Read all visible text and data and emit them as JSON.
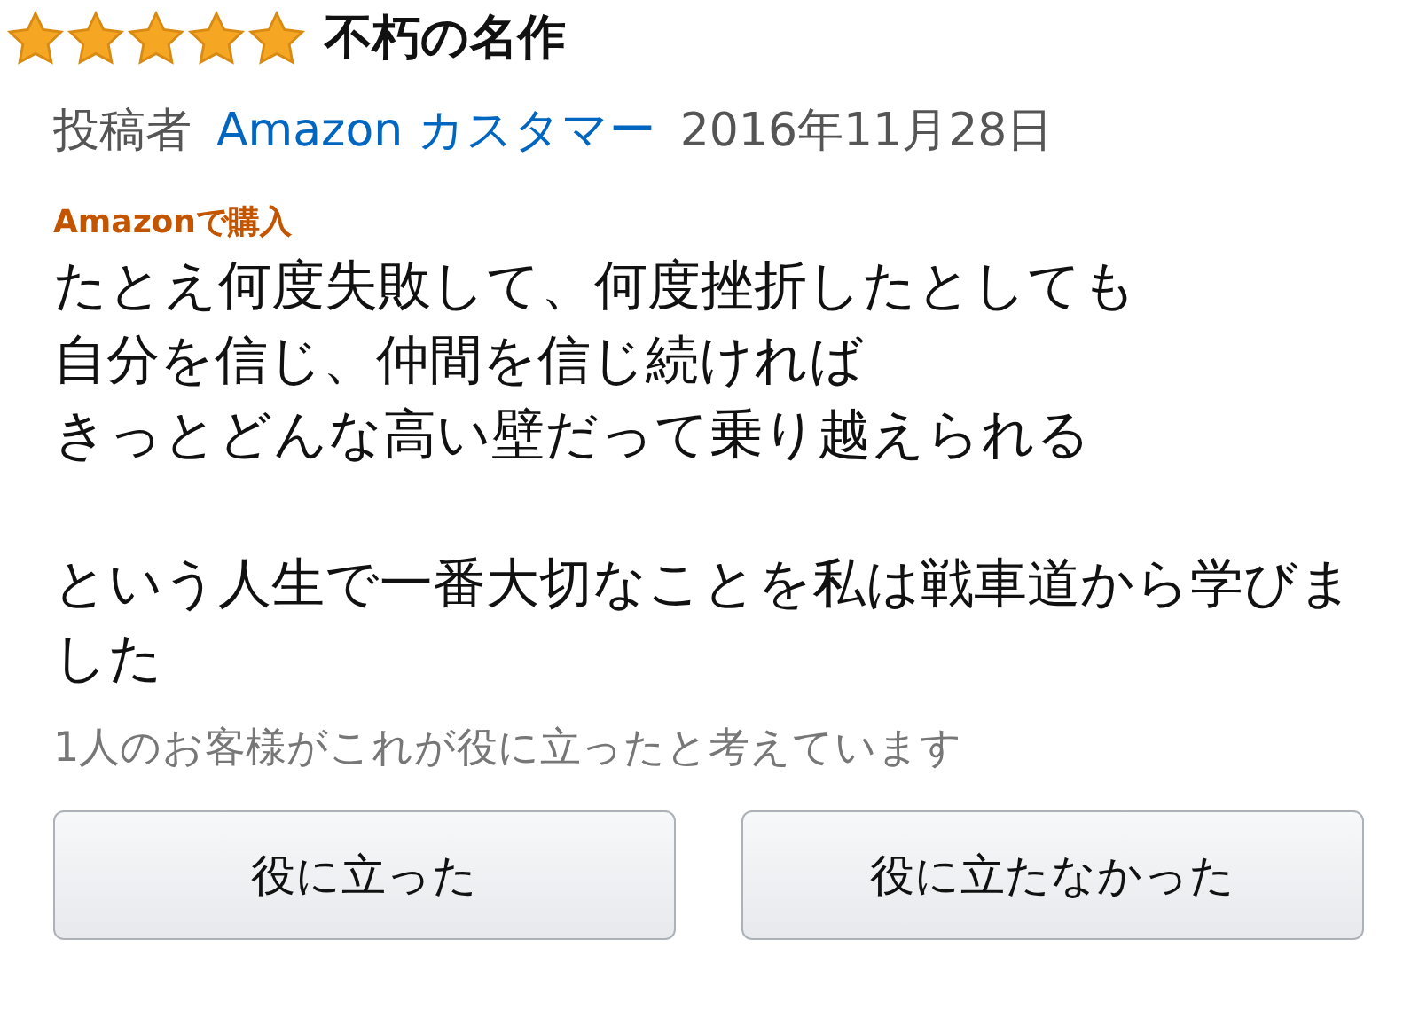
{
  "review": {
    "stars": 5,
    "title": "不朽の名作",
    "byline": {
      "prefix": "投稿者",
      "author": "Amazon カスタマー",
      "date": "2016年11月28日"
    },
    "badge": "Amazonで購入",
    "paragraphs": [
      {
        "lines": [
          "たとえ何度失敗して、何度挫折したとしても",
          "自分を信じ、仲間を信じ続ければ",
          "きっとどんな高い壁だって乗り越えられる"
        ]
      },
      {
        "lines": [
          "という人生で一番大切なことを私は戦車道から学びました"
        ]
      }
    ],
    "helpful_count": "1人のお客様がこれが役に立ったと考えています",
    "buttons": [
      "役に立った",
      "役に立たなかった"
    ]
  }
}
